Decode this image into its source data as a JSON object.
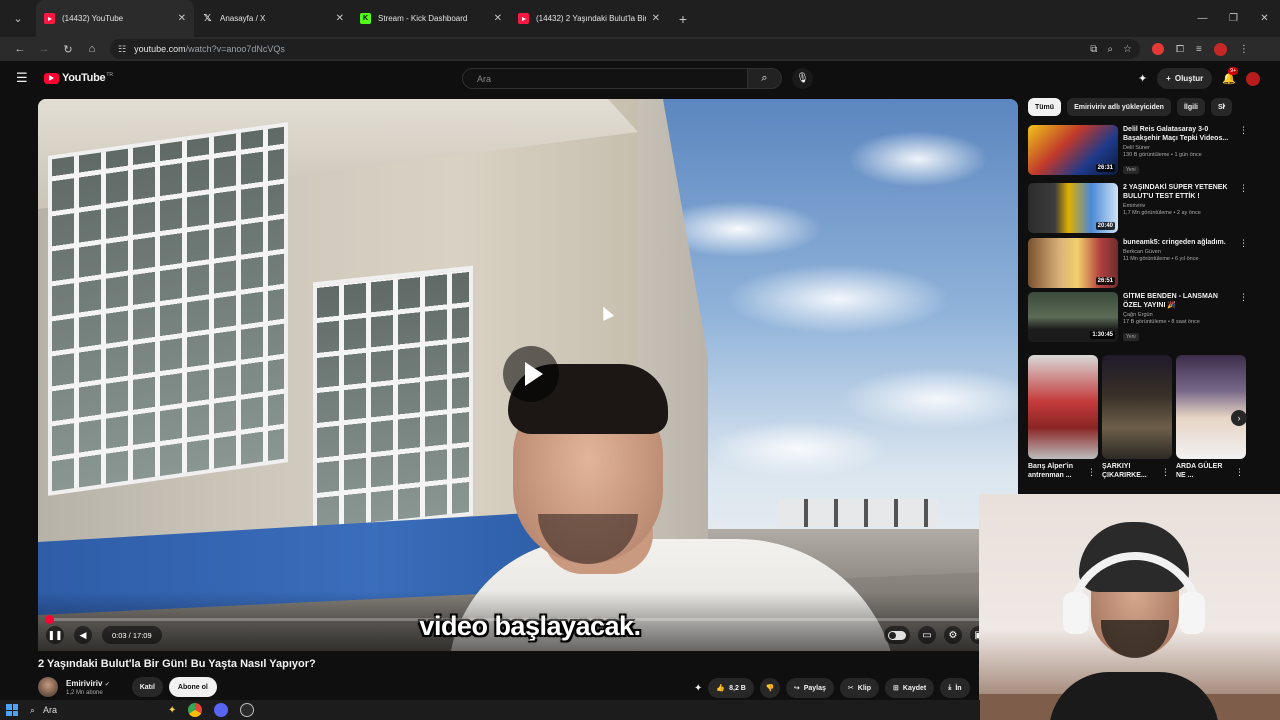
{
  "browser": {
    "tabs": [
      {
        "title": "(14432) YouTube",
        "icon": "youtube-icon",
        "active": true
      },
      {
        "title": "Anasayfa / X",
        "icon": "x-icon",
        "active": false
      },
      {
        "title": "Stream - Kick Dashboard",
        "icon": "kick-icon",
        "active": false
      },
      {
        "title": "(14432) 2 Yaşındaki Bulut'la Bir",
        "icon": "youtube-icon",
        "active": false
      }
    ],
    "url_host": "youtube.com",
    "url_path": "/watch?v=anoo7dNcVQs"
  },
  "youtube": {
    "logo_text": "YouTube",
    "logo_country": "TR",
    "search_placeholder": "Ara",
    "create_label": "Oluştur",
    "notification_count": "9+"
  },
  "player": {
    "subtitle": "video başlayacak.",
    "time": "0:03 / 17:09",
    "progress_fraction": 0.003
  },
  "video": {
    "title": "2 Yaşındaki Bulut'la Bir Gün! Bu Yaşta Nasıl Yapıyor?",
    "channel": "Emiriviriv",
    "subscribers": "1,2 Mn abone",
    "join_label": "Katıl",
    "subscribe_label": "Abone ol",
    "likes": "8,2 B",
    "share_label": "Paylaş",
    "clip_label": "Klip",
    "save_label": "Kaydet",
    "download_label": "İn"
  },
  "sidebar": {
    "chips": [
      "Tümü",
      "Emiriviriv adlı yükleyiciden",
      "İlgili",
      "Si"
    ],
    "recommendations": [
      {
        "title": "Delil Reis Galatasaray 3-0 Başakşehir Maçı Tepki Videos...",
        "channel": "Delil Süner",
        "stats": "130 B görüntüleme • 1 gün önce",
        "duration": "26:31",
        "badge": "Yeni"
      },
      {
        "title": "2 YAŞINDAKİ SÜPER YETENEK BULUT'U TEST ETTİK !",
        "channel": "Emiriviriv",
        "stats": "1,7 Mn görüntüleme • 2 ay önce",
        "duration": "20:40",
        "badge": ""
      },
      {
        "title": "buneamk5: cringeden ağladım.",
        "channel": "Berkcan Güven",
        "stats": "11 Mn görüntüleme • 6 yıl önce",
        "duration": "26:51",
        "badge": ""
      },
      {
        "title": "GİTME BENDEN - LANSMAN ÖZEL YAYINI 🎉",
        "channel": "Çağrı Ergün",
        "stats": "17 B görüntüleme • 8 saat önce",
        "duration": "1:30:45",
        "badge": "Yeni"
      }
    ],
    "shorts": [
      {
        "title": "Barış Alper'in antrenman ..."
      },
      {
        "title": "ŞARKIYI ÇIKARIRKE..."
      },
      {
        "title": "ARDA GÜLER NE ..."
      }
    ]
  },
  "taskbar": {
    "search_label": "Ara"
  },
  "colors": {
    "accent": "#ff0033",
    "background": "#0f0f0f"
  }
}
